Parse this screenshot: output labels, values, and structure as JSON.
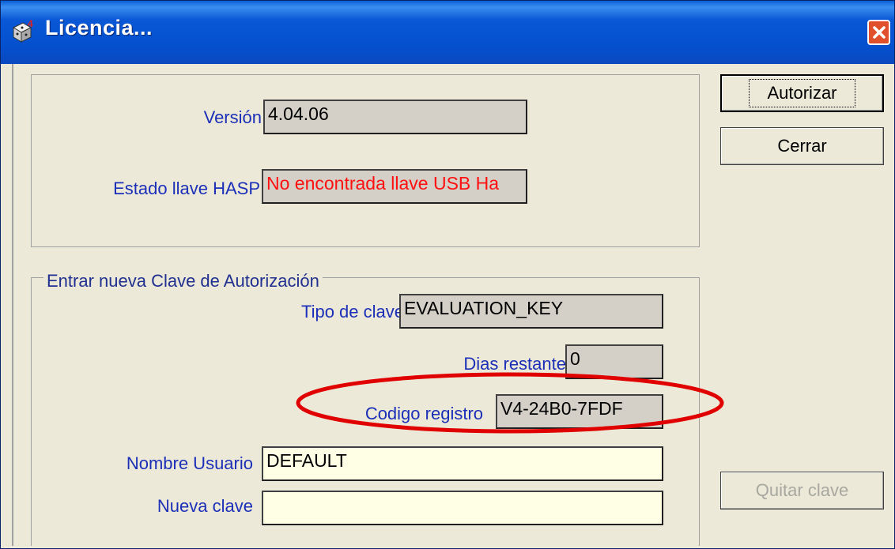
{
  "window": {
    "title": "Licencia...",
    "icon": "application-dice-icon",
    "close_icon": "close-icon"
  },
  "info": {
    "version_label": "Versión",
    "version_value": "4.04.06",
    "hasp_label": "Estado llave HASP",
    "hasp_value": "No encontrada llave USB Ha"
  },
  "auth_group": {
    "legend": "Entrar nueva Clave de Autorización",
    "key_type_label": "Tipo de clave",
    "key_type_value": "EVALUATION_KEY",
    "days_label": "Dias restantes",
    "days_value": "0",
    "reg_code_label": "Codigo registro",
    "reg_code_value": "V4-24B0-7FDF",
    "user_label": "Nombre Usuario",
    "user_value": "DEFAULT",
    "new_key_label": "Nueva clave",
    "new_key_value": ""
  },
  "buttons": {
    "authorize": "Autorizar",
    "close": "Cerrar",
    "remove_key": "Quitar clave"
  },
  "colors": {
    "highlight_oval": "#e00000",
    "label_blue": "#1c2fb8",
    "error_red": "#ff1010"
  }
}
